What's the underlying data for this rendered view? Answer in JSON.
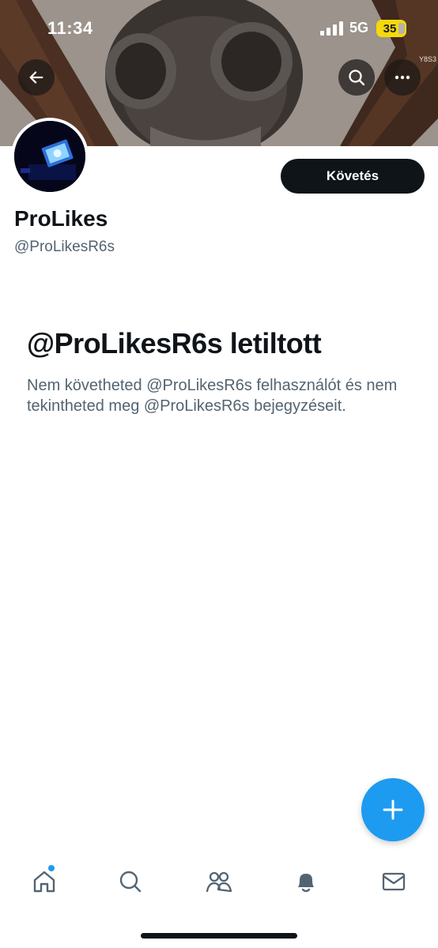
{
  "status_bar": {
    "time": "11:34",
    "network": "5G",
    "battery": "35",
    "battery_color": "#f5d90a"
  },
  "header": {
    "watermark": "Y8S3",
    "back_icon": "arrow-left-icon",
    "search_icon": "search-icon",
    "more_icon": "more-horizontal-icon"
  },
  "profile": {
    "display_name": "ProLikes",
    "handle": "@ProLikesR6s",
    "follow_label": "Követés"
  },
  "blocked": {
    "title": "@ProLikesR6s letiltott",
    "message": "Nem követheted @ProLikesR6s felhasználót és nem tekintheted meg @ProLikesR6s bejegyzéseit."
  },
  "fab": {
    "icon": "plus-icon",
    "color": "#1d9bf0"
  },
  "bottom_nav": {
    "items": [
      {
        "icon": "home-icon",
        "has_badge": true
      },
      {
        "icon": "search-icon"
      },
      {
        "icon": "communities-icon"
      },
      {
        "icon": "bell-icon"
      },
      {
        "icon": "mail-icon"
      }
    ],
    "accent": "#1d9bf0"
  }
}
